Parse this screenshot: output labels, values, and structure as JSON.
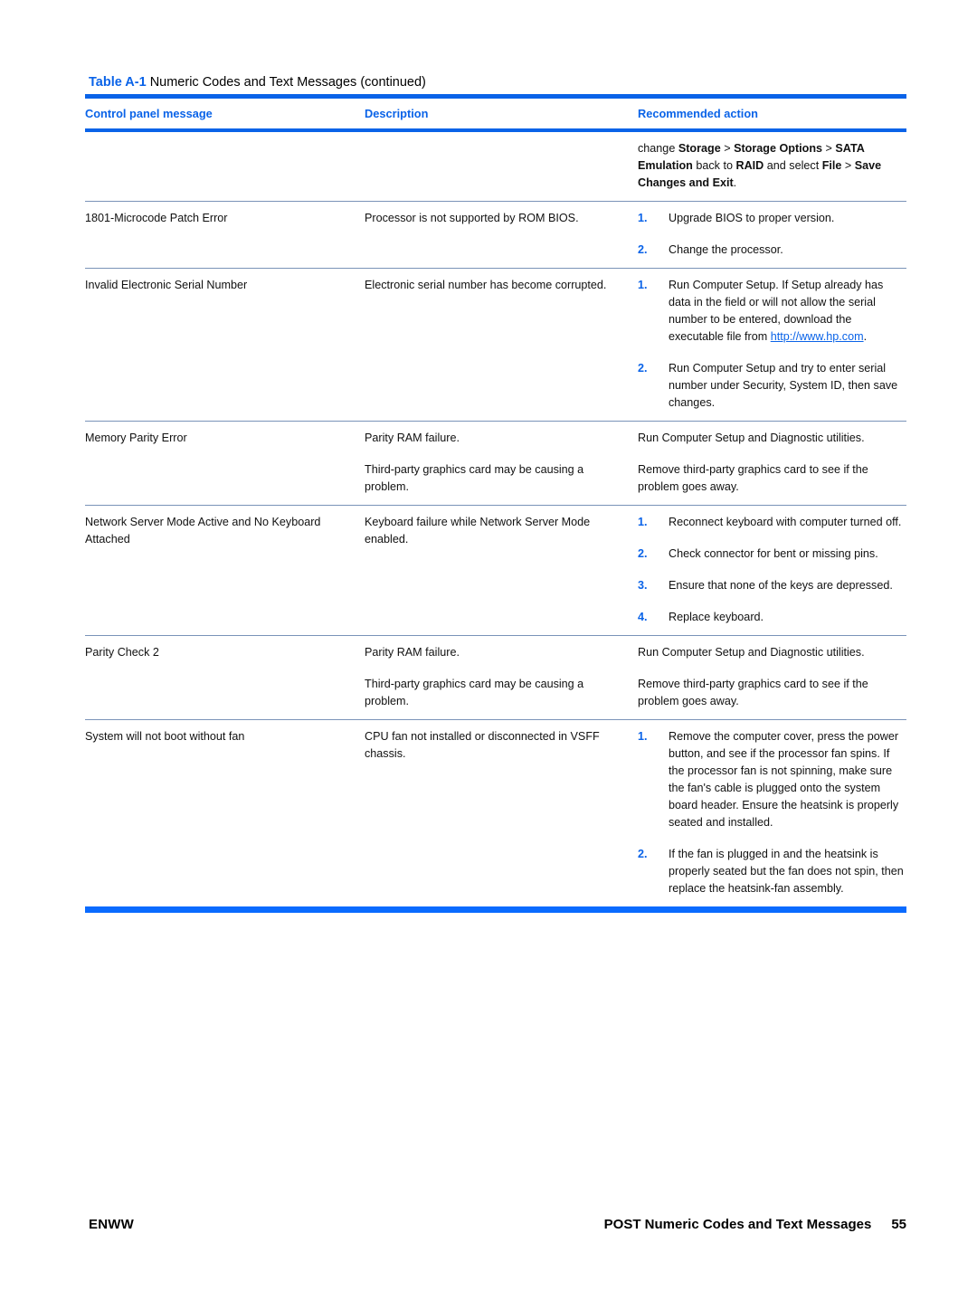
{
  "caption": {
    "label": "Table A-1",
    "text": "Numeric Codes and Text Messages (continued)"
  },
  "table": {
    "headers": {
      "col1": "Control panel message",
      "col2": "Description",
      "col3": "Recommended action"
    },
    "rows": [
      {
        "message": "",
        "description": "",
        "action_intro_parts": [
          {
            "t": "change ",
            "b": false
          },
          {
            "t": "Storage",
            "b": true
          },
          {
            "t": " > ",
            "b": false
          },
          {
            "t": "Storage Options",
            "b": true
          },
          {
            "t": " > ",
            "b": false
          },
          {
            "t": "SATA Emulation",
            "b": true
          },
          {
            "t": " back to ",
            "b": false
          },
          {
            "t": "RAID",
            "b": true
          },
          {
            "t": " and select ",
            "b": false
          },
          {
            "t": "File",
            "b": true
          },
          {
            "t": " > ",
            "b": false
          },
          {
            "t": "Save Changes and Exit",
            "b": true
          },
          {
            "t": ".",
            "b": false
          }
        ],
        "action_steps": []
      },
      {
        "message": "1801-Microcode Patch Error",
        "description": "Processor is not supported by ROM BIOS.",
        "action_steps": [
          {
            "num": "1.",
            "text": "Upgrade BIOS to proper version."
          },
          {
            "num": "2.",
            "text": "Change the processor."
          }
        ]
      },
      {
        "message": "Invalid Electronic Serial Number",
        "description": "Electronic serial number has become corrupted.",
        "action_steps": [
          {
            "num": "1.",
            "text": "Run Computer Setup. If Setup already has data in the field or will not allow the serial number to be entered, download the executable file from ",
            "link": "http://www.hp.com",
            "after_link": "."
          },
          {
            "num": "2.",
            "text": "Run Computer Setup and try to enter serial number under Security, System ID, then save changes."
          }
        ]
      },
      {
        "message": "Memory Parity Error",
        "description_paras": [
          "Parity RAM failure.",
          "Third-party graphics card may be causing a problem."
        ],
        "action_paras": [
          "Run Computer Setup and Diagnostic utilities.",
          "Remove third-party graphics card to see if the problem goes away."
        ]
      },
      {
        "message": "Network Server Mode Active and No Keyboard Attached",
        "description": "Keyboard failure while Network Server Mode enabled.",
        "action_steps": [
          {
            "num": "1.",
            "text": "Reconnect keyboard with computer turned off."
          },
          {
            "num": "2.",
            "text": "Check connector for bent or missing pins."
          },
          {
            "num": "3.",
            "text": "Ensure that none of the keys are depressed."
          },
          {
            "num": "4.",
            "text": "Replace keyboard."
          }
        ]
      },
      {
        "message": "Parity Check 2",
        "description_paras": [
          "Parity RAM failure.",
          "Third-party graphics card may be causing a problem."
        ],
        "action_paras": [
          "Run Computer Setup and Diagnostic utilities.",
          "Remove third-party graphics card to see if the problem goes away."
        ]
      },
      {
        "message": "System will not boot without fan",
        "description": "CPU fan not installed or disconnected in VSFF chassis.",
        "action_steps": [
          {
            "num": "1.",
            "text": "Remove the computer cover, press the power button, and see if the processor fan spins. If the processor fan is not spinning, make sure the fan's cable is plugged onto the system board header. Ensure the heatsink is properly seated and installed."
          },
          {
            "num": "2.",
            "text": "If the fan is plugged in and the heatsink is properly seated but the fan does not spin, then replace the heatsink-fan assembly."
          }
        ]
      }
    ]
  },
  "footer": {
    "left": "ENWW",
    "right": "POST Numeric Codes and Text Messages",
    "page": "55"
  },
  "colors": {
    "accent_blue": "#0a63e8",
    "rule_blue": "#0a6bff",
    "row_rule": "#7a93b8"
  }
}
